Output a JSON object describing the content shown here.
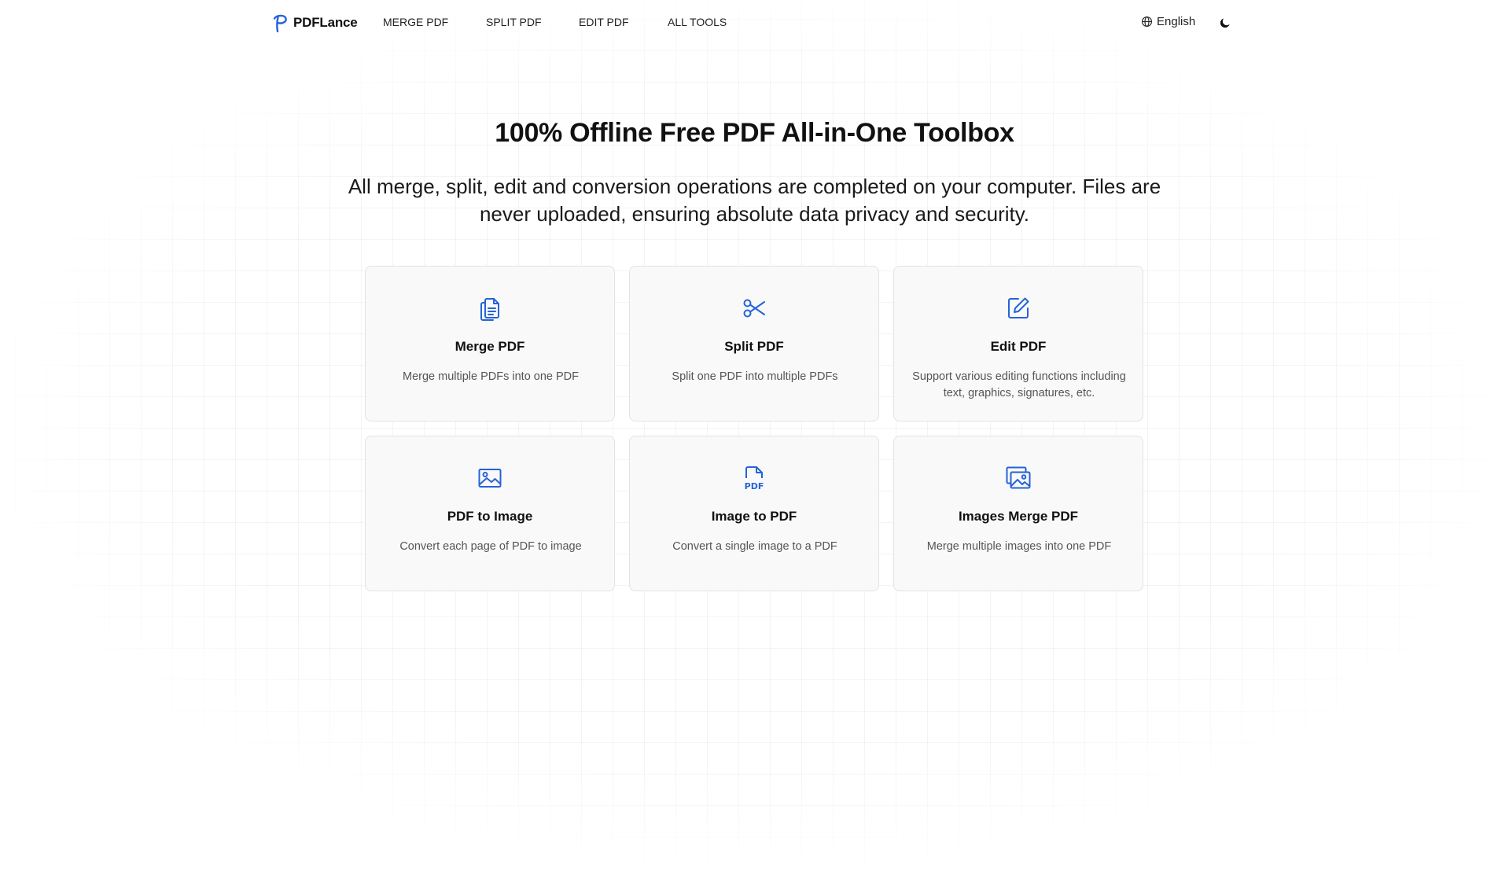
{
  "header": {
    "logo_text": "PDFLance",
    "nav": [
      {
        "label": "MERGE PDF"
      },
      {
        "label": "SPLIT PDF"
      },
      {
        "label": "EDIT PDF"
      },
      {
        "label": "ALL TOOLS"
      }
    ],
    "language": "English",
    "icons": {
      "logo": "pdflance-logo-icon",
      "language": "globe-icon",
      "theme": "moon-icon"
    }
  },
  "hero": {
    "title": "100% Offline Free PDF All-in-One Toolbox",
    "subtitle": "All merge, split, edit and conversion operations are completed on your computer. Files are never uploaded, ensuring absolute data privacy and security."
  },
  "tools": [
    {
      "title": "Merge PDF",
      "description": "Merge multiple PDFs into one PDF",
      "icon": "merge-files-icon"
    },
    {
      "title": "Split PDF",
      "description": "Split one PDF into multiple PDFs",
      "icon": "scissors-icon"
    },
    {
      "title": "Edit PDF",
      "description": "Support various editing functions including text, graphics, signatures, etc.",
      "icon": "edit-icon"
    },
    {
      "title": "PDF to Image",
      "description": "Convert each page of PDF to image",
      "icon": "image-icon"
    },
    {
      "title": "Image to PDF",
      "description": "Convert a single image to a PDF",
      "icon": "pdf-file-icon"
    },
    {
      "title": "Images Merge PDF",
      "description": "Merge multiple images into one PDF",
      "icon": "images-stack-icon"
    }
  ],
  "colors": {
    "accent": "#2563d8",
    "text": "#111111",
    "muted": "#555555",
    "card_bg": "#f9f9f9",
    "card_border": "#e3e3e3"
  }
}
